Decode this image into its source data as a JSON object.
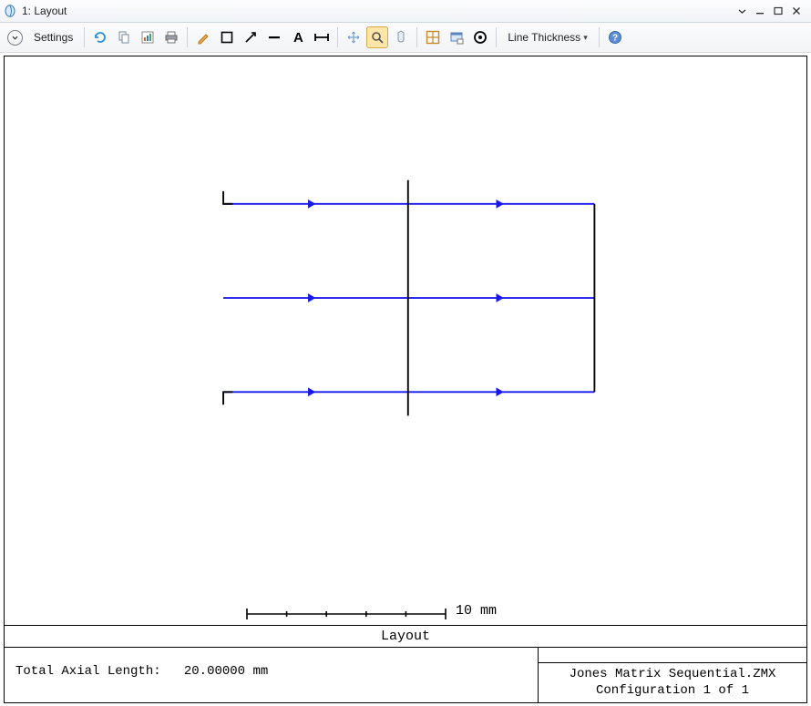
{
  "window": {
    "title": "1: Layout"
  },
  "toolbar": {
    "settings_label": "Settings",
    "line_thickness_label": "Line Thickness"
  },
  "canvas": {
    "title": "Layout",
    "scale_label": "10 mm",
    "total_axial_label": "Total Axial Length:",
    "total_axial_value": "20.00000 mm",
    "filename": "Jones Matrix Sequential.ZMX",
    "config_line": "Configuration 1 of 1"
  },
  "chart_data": {
    "type": "diagram",
    "description": "3 parallel blue rays with arrows pass left-to-right through a vertical black surface and terminate on a flat black image plane; short black aperture ticks mark the top and bottom ray entry points.",
    "rays": [
      {
        "y_fraction": 0.073,
        "x_start_fraction": 0.0,
        "x_end_fraction": 1.0,
        "arrow_x_fractions": [
          0.25,
          0.75
        ]
      },
      {
        "y_fraction": 0.5,
        "x_start_fraction": 0.0,
        "x_end_fraction": 1.0,
        "arrow_x_fractions": [
          0.25,
          0.75
        ]
      },
      {
        "y_fraction": 0.927,
        "x_start_fraction": 0.0,
        "x_end_fraction": 1.0,
        "arrow_x_fractions": [
          0.25,
          0.75
        ]
      }
    ],
    "vertical_surface_x_fraction": 0.5,
    "vertical_surface_y_extent_fraction": [
      -0.12,
      1.12
    ],
    "image_plane_x_fraction": 1.0,
    "image_plane_y_extent_fraction": [
      0.073,
      0.927
    ],
    "scale_bar": {
      "length_value": 10,
      "unit": "mm",
      "ticks": 6
    }
  }
}
